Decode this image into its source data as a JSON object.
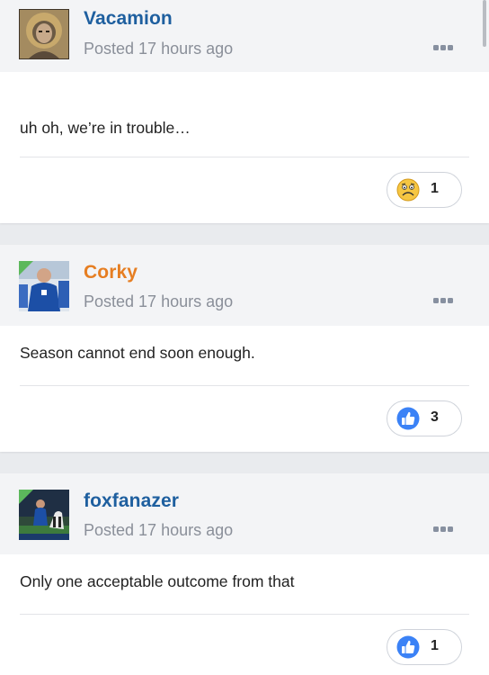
{
  "posts": [
    {
      "username": "Vacamion",
      "username_color": "#1e5f9f",
      "posted": "Posted 17 hours ago",
      "content": "uh oh, we’re in trouble…",
      "reaction": {
        "icon": "sad-face-emoji-icon",
        "count": "1"
      },
      "online": false
    },
    {
      "username": "Corky",
      "username_color": "#e67e22",
      "posted": "Posted 17 hours ago",
      "content": "Season cannot end soon enough.",
      "reaction": {
        "icon": "thumbs-up-icon",
        "count": "3"
      },
      "online": true
    },
    {
      "username": "foxfanazer",
      "username_color": "#1e5f9f",
      "posted": "Posted 17 hours ago",
      "content": "Only one acceptable outcome from that",
      "reaction": {
        "icon": "thumbs-up-icon",
        "count": "1"
      },
      "online": true
    }
  ],
  "colors": {
    "link_blue": "#1e5f9f",
    "orange_user": "#e67e22",
    "like_blue": "#3b82f6",
    "online_green": "#5cb85c",
    "emoji_yellow": "#f6c642"
  }
}
